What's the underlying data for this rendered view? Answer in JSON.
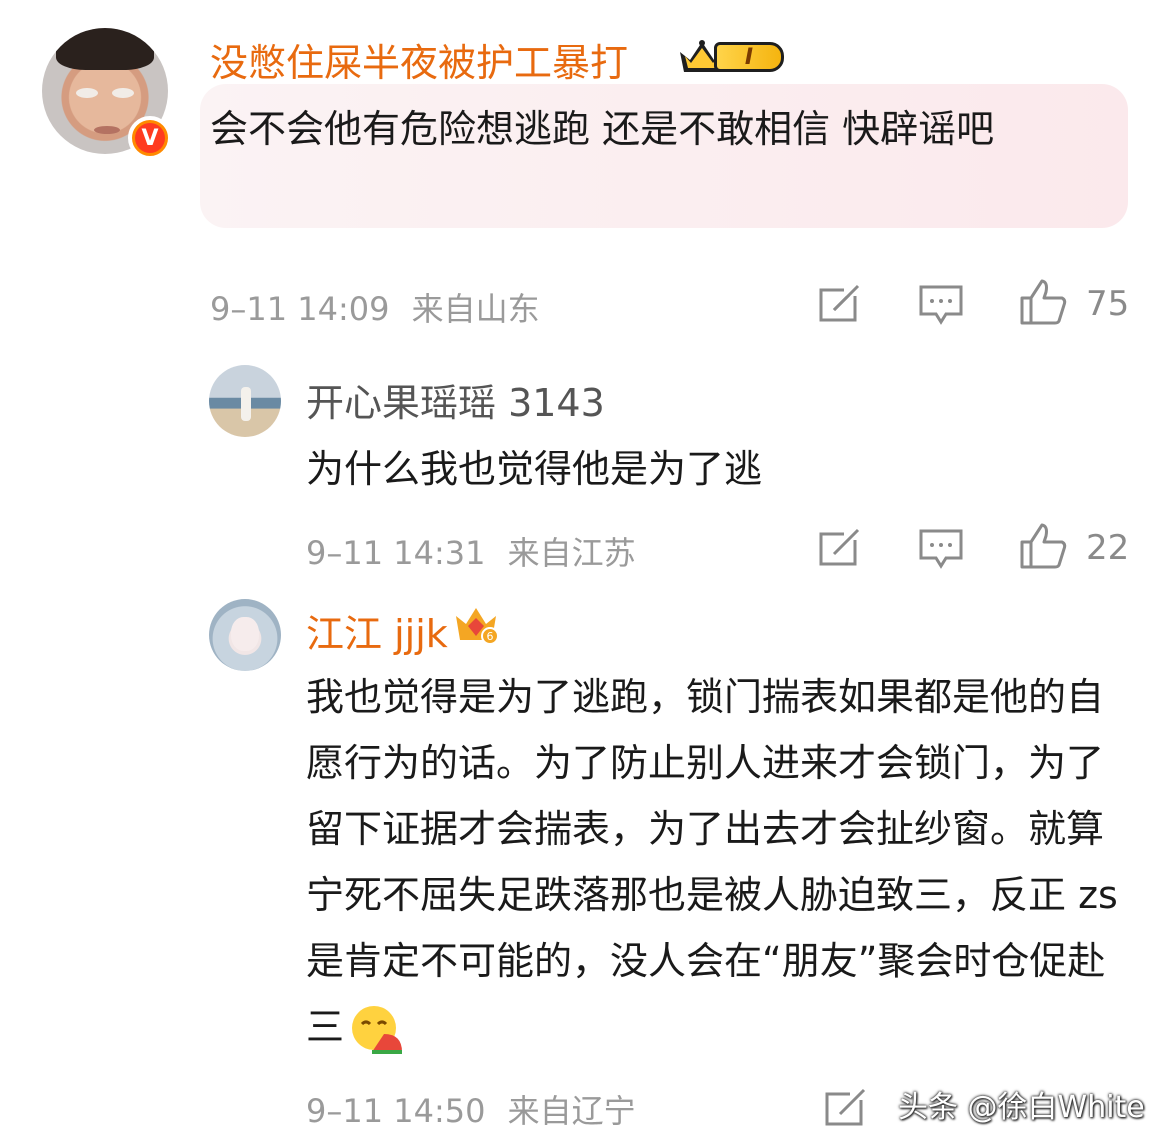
{
  "comment": {
    "username": "没憋住屎半夜被护工暴打",
    "level_badge": "I",
    "verified_badge": "V",
    "text": "会不会他有危险想逃跑 还是不敢相信 快辟谣吧",
    "timestamp": "9–11 14:09",
    "location": "来自山东",
    "likes": "75"
  },
  "replies": [
    {
      "username": "开心果瑶瑶 3143",
      "text": "为什么我也觉得他是为了逃",
      "timestamp": "9–11 14:31",
      "location": "来自江苏",
      "likes": "22"
    },
    {
      "username": "江江 jjjk",
      "crown_level": "6",
      "text": "我也觉得是为了逃跑，锁门揣表如果都是他的自愿行为的话。为了防止别人进来才会锁门，为了留下证据才会揣表，为了出去才会扯纱窗。就算宁死不屈失足跌落那也是被人胁迫致三，反正 zs 是肯定不可能的，没人会在“朋友”聚会时仓促赴三",
      "timestamp": "9–11 14:50",
      "location": "来自辽宁"
    }
  ],
  "watermark": "头条 @徐白White",
  "colors": {
    "username_vip": "#e86a0f",
    "username_normal": "#555555",
    "meta": "#9a9a9a",
    "bubble": "#fbeef0"
  },
  "icons": [
    "repost-icon",
    "comment-icon",
    "like-icon",
    "emoji-watermelon-icon"
  ]
}
